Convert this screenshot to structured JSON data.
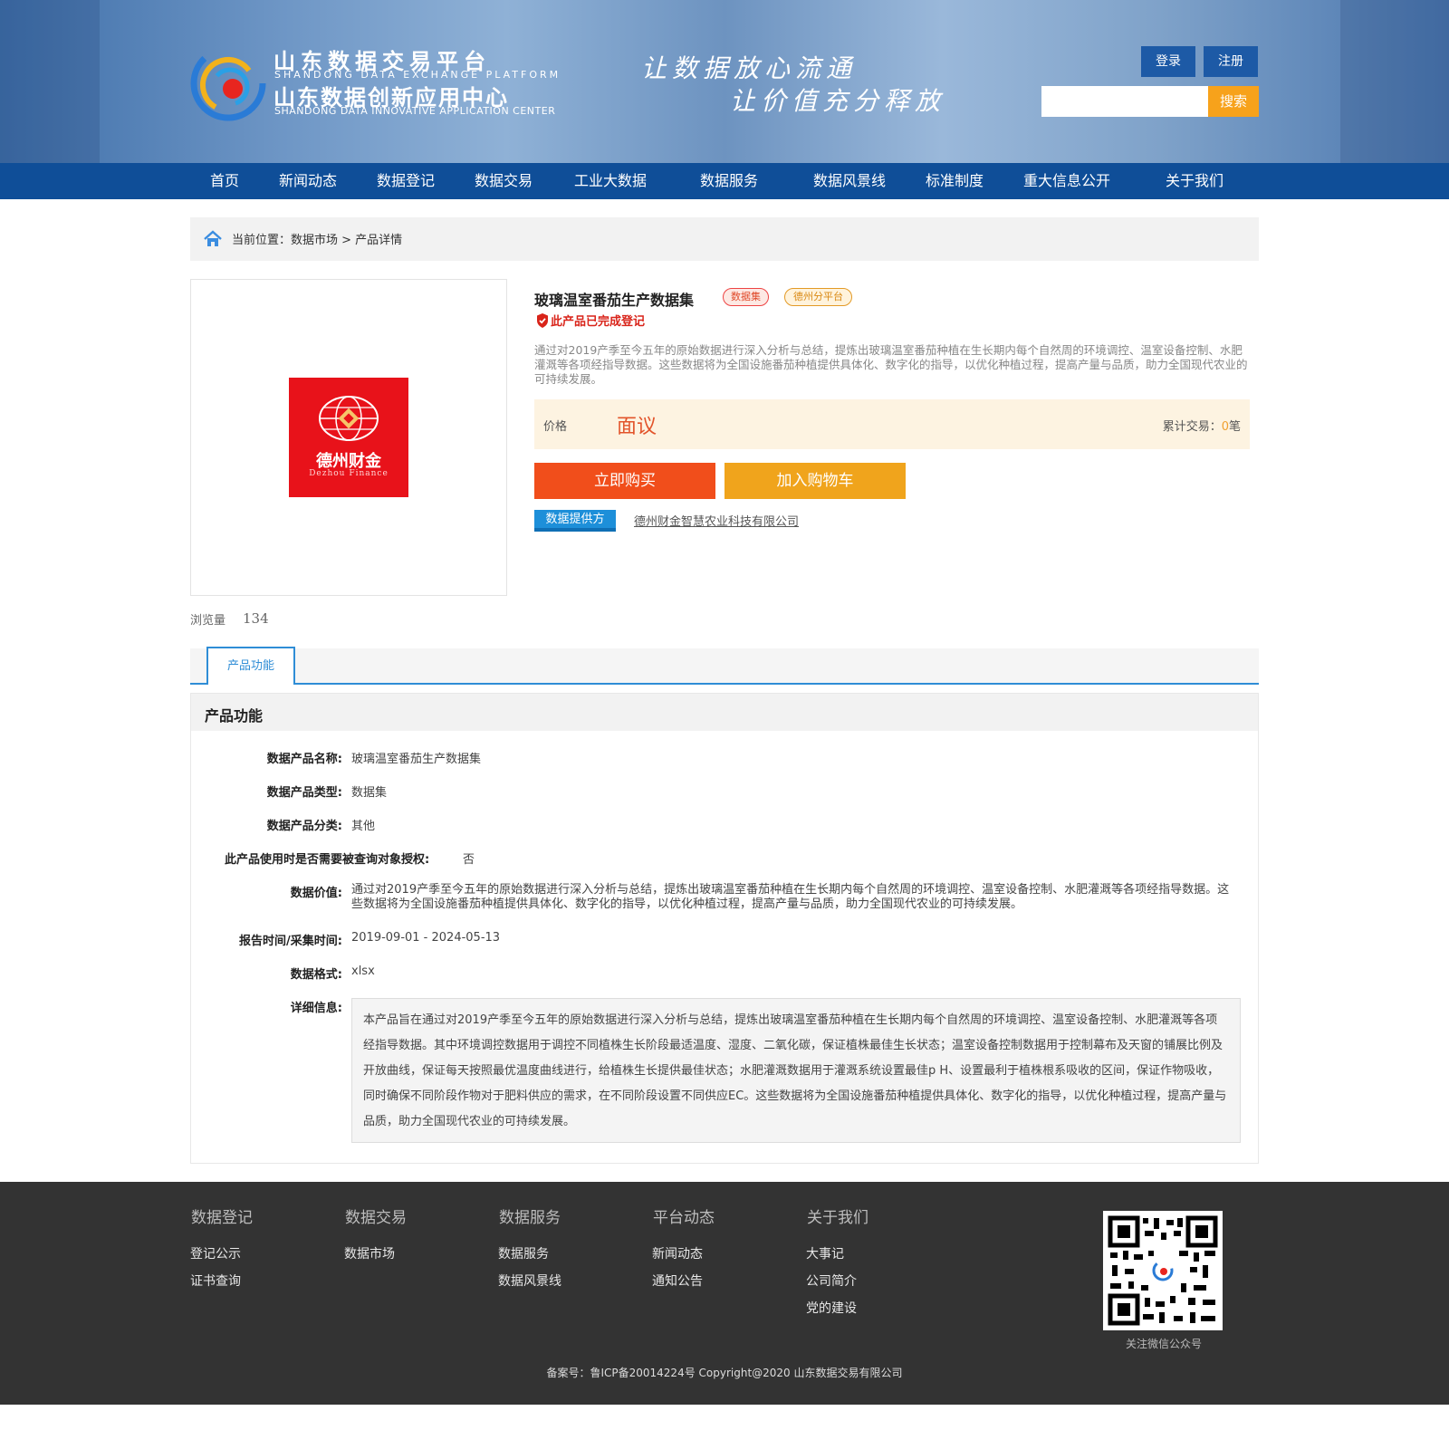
{
  "header": {
    "logo_title": "山东数据交易平台",
    "logo_subtitle": "SHANDONG DATA EXCHANGE PLATFORM",
    "logo_title2": "山东数据创新应用中心",
    "logo_subtitle2": "SHANDONG DATA INNOVATIVE APPLICATION CENTER",
    "slogan_line1": "让数据放心流通",
    "slogan_line2": "让价值充分释放",
    "login_label": "登录",
    "register_label": "注册",
    "search_placeholder": "",
    "search_label": "搜索"
  },
  "nav": {
    "items": [
      "首页",
      "新闻动态",
      "数据登记",
      "数据交易",
      "工业大数据",
      "数据服务",
      "数据风景线",
      "标准制度",
      "重大信息公开",
      "关于我们"
    ]
  },
  "breadcrumb": {
    "text": "当前位置：数据市场 > 产品详情"
  },
  "product": {
    "logo_cn": "德州财金",
    "logo_en": "Dezhou Finance",
    "views_label": "浏览量",
    "views_count": "134",
    "title": "玻璃温室番茄生产数据集",
    "tag_type": "数据集",
    "tag_platform": "德州分平台",
    "registered_text": "此产品已完成登记",
    "description": "通过对2019产季至今五年的原始数据进行深入分析与总结，提炼出玻璃温室番茄种植在生长期内每个自然周的环境调控、温室设备控制、水肥灌溉等各项经指导数据。这些数据将为全国设施番茄种植提供具体化、数字化的指导，以优化种植过程，提高产量与品质，助力全国现代农业的可持续发展。",
    "price_label": "价格",
    "price_value": "面议",
    "trades_label": "累计交易：",
    "trades_count": "0",
    "trades_unit": "笔",
    "buy_label": "立即购买",
    "cart_label": "加入购物车",
    "provider_label": "数据提供方",
    "provider_name": "德州财金智慧农业科技有限公司"
  },
  "tabs": {
    "active": "产品功能"
  },
  "panel": {
    "title": "产品功能",
    "rows": [
      {
        "label": "数据产品名称:",
        "value": "玻璃温室番茄生产数据集"
      },
      {
        "label": "数据产品类型:",
        "value": "数据集"
      },
      {
        "label": "数据产品分类:",
        "value": "其他"
      },
      {
        "label": "此产品使用时是否需要被查询对象授权:",
        "value": "否"
      },
      {
        "label": "数据价值:",
        "value": "通过对2019产季至今五年的原始数据进行深入分析与总结，提炼出玻璃温室番茄种植在生长期内每个自然周的环境调控、温室设备控制、水肥灌溉等各项经指导数据。这些数据将为全国设施番茄种植提供具体化、数字化的指导，以优化种植过程，提高产量与品质，助力全国现代农业的可持续发展。"
      },
      {
        "label": "报告时间/采集时间:",
        "value": "2019-09-01 - 2024-05-13"
      },
      {
        "label": "数据格式:",
        "value": "xlsx"
      },
      {
        "label": "详细信息:",
        "value": "本产品旨在通过对2019产季至今五年的原始数据进行深入分析与总结，提炼出玻璃温室番茄种植在生长期内每个自然周的环境调控、温室设备控制、水肥灌溉等各项经指导数据。其中环境调控数据用于调控不同植株生长阶段最适温度、湿度、二氧化碳，保证植株最佳生长状态；温室设备控制数据用于控制幕布及天窗的铺展比例及开放曲线，保证每天按照最优温度曲线进行，给植株生长提供最佳状态；水肥灌溉数据用于灌溉系统设置最佳p H、设置最利于植株根系吸收的区间，保证作物吸收，同时确保不同阶段作物对于肥料供应的需求，在不同阶段设置不同供应EC。这些数据将为全国设施番茄种植提供具体化、数字化的指导，以优化种植过程，提高产量与品质，助力全国现代农业的可持续发展。"
      }
    ]
  },
  "footer": {
    "columns": [
      {
        "title": "数据登记",
        "links": [
          "登记公示",
          "证书查询"
        ]
      },
      {
        "title": "数据交易",
        "links": [
          "数据市场"
        ]
      },
      {
        "title": "数据服务",
        "links": [
          "数据服务",
          "数据风景线"
        ]
      },
      {
        "title": "平台动态",
        "links": [
          "新闻动态",
          "通知公告"
        ]
      },
      {
        "title": "关于我们",
        "links": [
          "大事记",
          "公司简介",
          "党的建设"
        ]
      }
    ],
    "qr_caption": "关注微信公众号",
    "copyright": "备案号：鲁ICP备20014224号 Copyright@2020 山东数据交易有限公司"
  },
  "colors": {
    "nav_bg": "#0f4e98",
    "buy": "#f14e1b",
    "cart": "#f0a41c",
    "search": "#f7a21b",
    "tab_accent": "#2f8dd6",
    "footer_bg": "#333333"
  }
}
